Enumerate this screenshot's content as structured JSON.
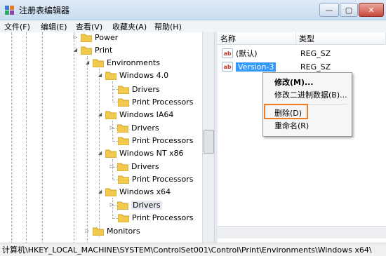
{
  "window": {
    "title": "注册表编辑器",
    "minimize": "—",
    "maximize": "▢",
    "close": "✕"
  },
  "menu": [
    "文件(F)",
    "编辑(E)",
    "查看(V)",
    "收藏夹(A)",
    "帮助(H)"
  ],
  "tree": {
    "items": [
      {
        "label": "Power"
      },
      {
        "label": "Print"
      },
      {
        "label": "Environments"
      },
      {
        "label": "Windows 4.0"
      },
      {
        "label": "Drivers"
      },
      {
        "label": "Print Processors"
      },
      {
        "label": "Windows IA64"
      },
      {
        "label": "Drivers"
      },
      {
        "label": "Print Processors"
      },
      {
        "label": "Windows NT x86"
      },
      {
        "label": "Drivers"
      },
      {
        "label": "Print Processors"
      },
      {
        "label": "Windows x64"
      },
      {
        "label": "Drivers"
      },
      {
        "label": "Print Processors"
      },
      {
        "label": "Monitors"
      }
    ]
  },
  "values_pane": {
    "columns": [
      "名称",
      "类型"
    ],
    "rows": [
      {
        "name": "(默认)",
        "type": "REG_SZ",
        "icon": "ab"
      },
      {
        "name": "Version-3",
        "type": "REG_SZ",
        "icon": "ab"
      }
    ]
  },
  "context_menu": {
    "items": [
      "修改(M)...",
      "修改二进制数据(B)...",
      "删除(D)",
      "重命名(R)"
    ]
  },
  "status_bar": {
    "path": "计算机\\HKEY_LOCAL_MACHINE\\SYSTEM\\ControlSet001\\Control\\Print\\Environments\\Windows x64\\"
  },
  "colors": {
    "selection": "#3399ff",
    "highlight_box": "#ef7d22",
    "folder": "#f2c94c"
  }
}
